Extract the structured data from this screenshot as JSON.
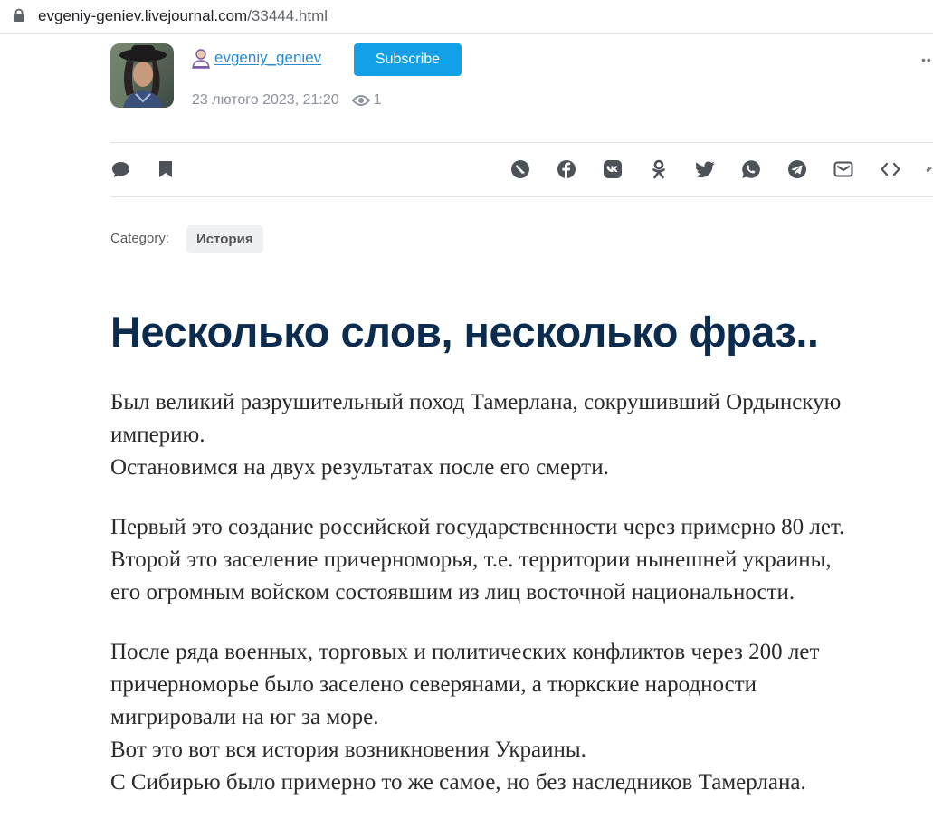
{
  "browser": {
    "url_domain": "evgeniy-geniev.livejournal.com",
    "url_path": "/33444.html"
  },
  "author": {
    "username": "evgeniy_geniev",
    "subscribe_label": "Subscribe",
    "date": "23 лютого 2023, 21:20",
    "views": "1"
  },
  "actions": {
    "left": [
      "comment-icon",
      "bookmark-icon"
    ],
    "share": [
      "livejournal-icon",
      "facebook-icon",
      "vk-icon",
      "odnoklassniki-icon",
      "twitter-icon",
      "whatsapp-icon",
      "telegram-icon",
      "email-icon",
      "embed-icon",
      "link-icon"
    ]
  },
  "category": {
    "label": "Category:",
    "tag": "История"
  },
  "post": {
    "title": "Несколько слов, несколько фраз..",
    "lines": [
      "Был великий разрушительный поход Тамерлана, сокрушивший Ордынскую",
      "империю.",
      "Остановимся на двух результатах после его смерти.",
      "Первый это создание российской государственности через примерно 80 лет.",
      "Второй это заселение причерноморья, т.е. территории нынешней украины,",
      "его огромным войском состоявшим из лиц восточной национальности.",
      "После ряда военных, торговых и политических конфликтов через 200 лет",
      "причерноморье было заселено северянами, а тюркские народности",
      "мигрировали на юг за море.",
      "Вот это вот вся история возникновения Украины.",
      "С Сибирью было примерно то же самое, но без наследников Тамерлана."
    ]
  },
  "colors": {
    "subscribe_bg": "#12a1e6",
    "title": "#0b2c4f",
    "link": "#2a8bd0",
    "icon": "#4d5258"
  }
}
